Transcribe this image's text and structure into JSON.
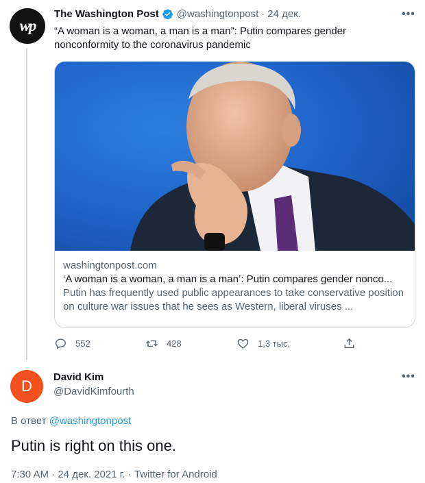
{
  "tweet": {
    "author_name": "The Washington Post",
    "avatar_text": "wp",
    "handle": "@washingtonpost",
    "separator": "·",
    "date": "24 дек.",
    "text": "“A woman is a woman, a man is a man”: Putin compares gender nonconformity to the coronavirus pandemic",
    "card": {
      "domain": "washingtonpost.com",
      "title": "‘A woman is a woman, a man is a man’: Putin compares gender nonco...",
      "description": "Putin has frequently used public appearances to take conservative position on culture war issues that he sees as Western, liberal viruses ..."
    },
    "actions": {
      "replies": "552",
      "retweets": "428",
      "likes": "1,3 тыс."
    }
  },
  "reply": {
    "avatar_letter": "D",
    "author_name": "David Kim",
    "handle": "@DavidKimfourth",
    "reply_to_prefix": "В ответ",
    "reply_to_handle": "@washingtonpost",
    "text": "Putin is right on this one.",
    "meta": "7:30 AM · 24 дек. 2021 г. · Twitter for Android"
  },
  "icons": {
    "verified": "verified-badge-icon",
    "more": "more-icon",
    "reply": "reply-icon",
    "retweet": "retweet-icon",
    "like": "heart-icon",
    "share": "share-icon"
  },
  "colors": {
    "accent": "#1d9bf0",
    "muted": "#536471",
    "avatar_reply": "#f4511e"
  }
}
